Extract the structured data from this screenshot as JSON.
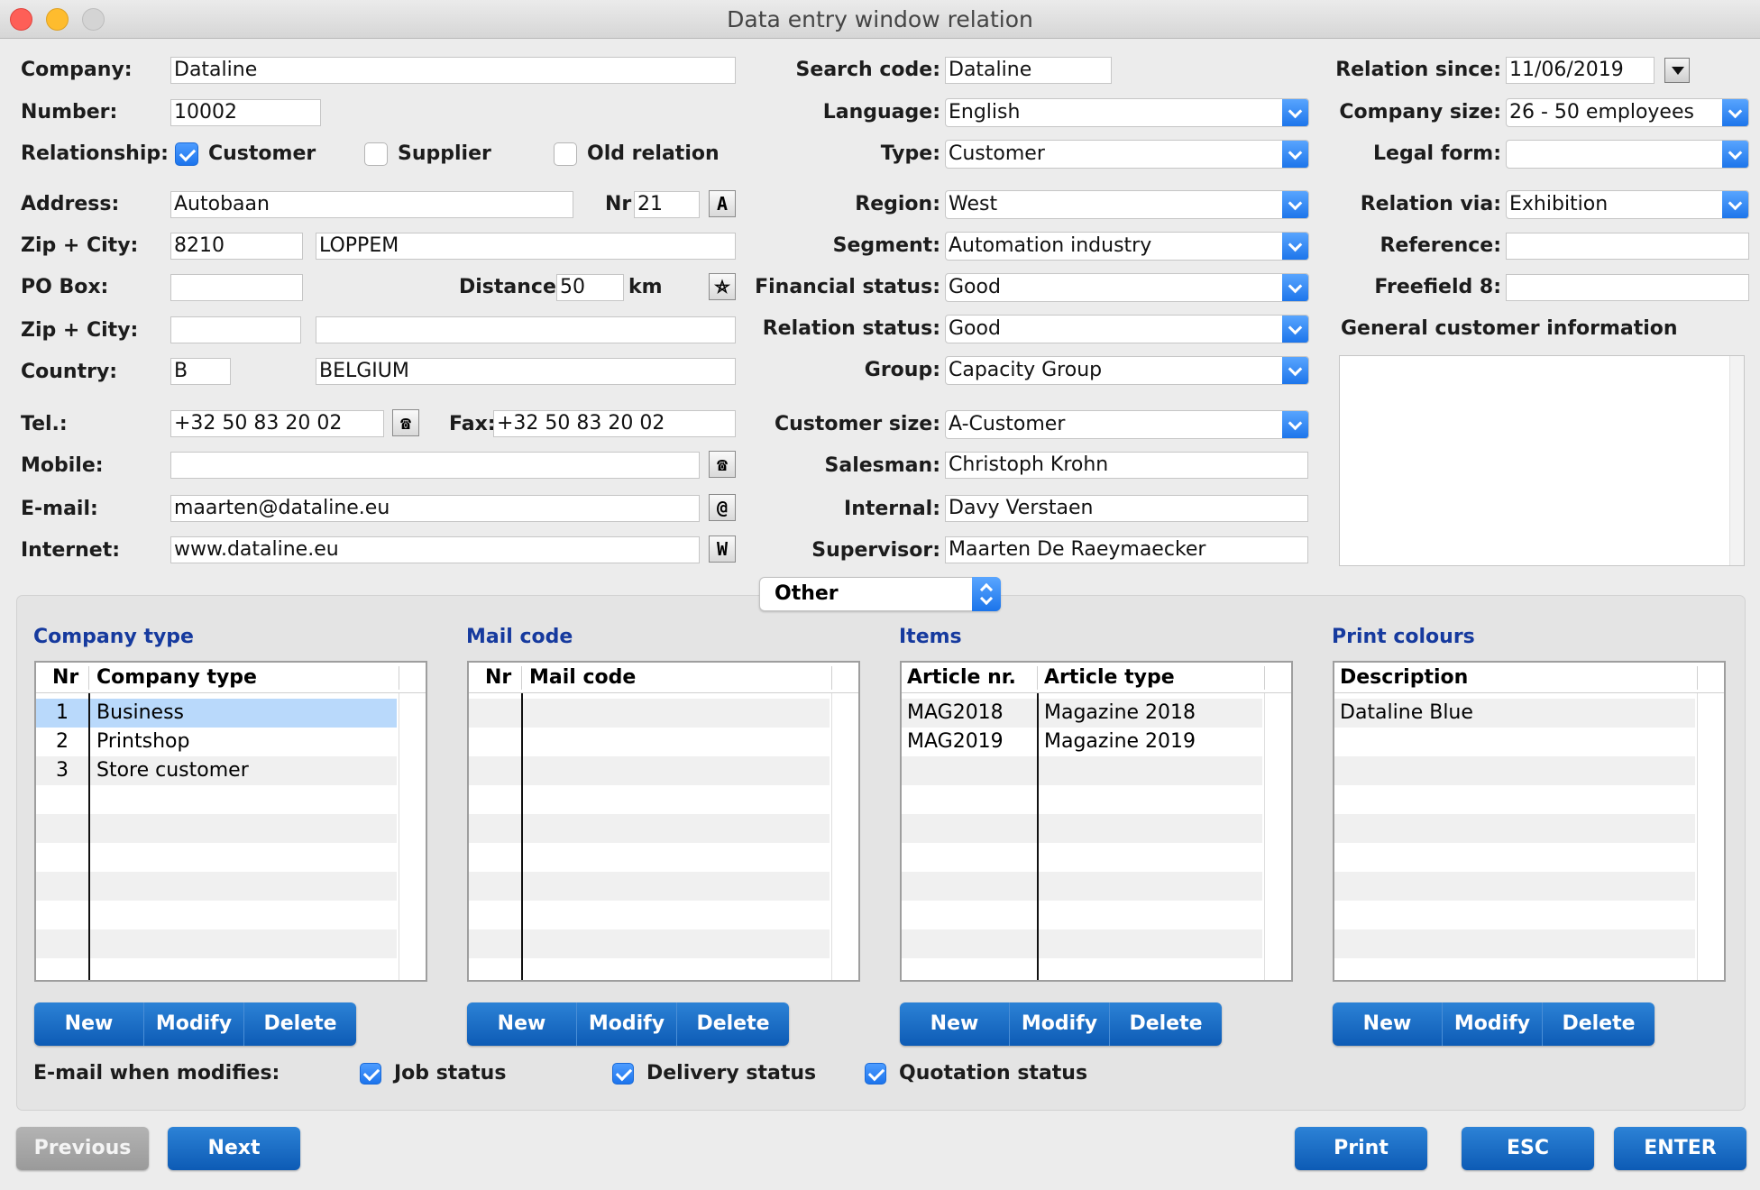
{
  "window": {
    "title": "Data entry window relation"
  },
  "left": {
    "company_label": "Company:",
    "company": "Dataline",
    "number_label": "Number:",
    "number": "10002",
    "relationship_label": "Relationship:",
    "customer_label": "Customer",
    "supplier_label": "Supplier",
    "old_relation_label": "Old relation",
    "address_label": "Address:",
    "address": "Autobaan",
    "nr_label": "Nr",
    "nr": "21",
    "zip_city_label": "Zip + City:",
    "zip": "8210",
    "city": "LOPPEM",
    "po_box_label": "PO Box:",
    "po_box": "",
    "distance_label": "Distance:",
    "distance": "50",
    "km_label": "km",
    "zip_city2_label": "Zip + City:",
    "zip2": "",
    "city2": "",
    "country_label": "Country:",
    "country_code": "B",
    "country": "BELGIUM",
    "tel_label": "Tel.:",
    "tel": "+32 50 83 20 02",
    "fax_label": "Fax:",
    "fax": "+32 50 83 20 02",
    "mobile_label": "Mobile:",
    "mobile": "",
    "email_label": "E-mail:",
    "email": "maarten@dataline.eu",
    "internet_label": "Internet:",
    "internet": "www.dataline.eu",
    "icons": {
      "address": "A",
      "distance": "⛤",
      "phone": "☎",
      "email": "@",
      "web": "W"
    }
  },
  "middle": {
    "search_code_label": "Search code:",
    "search_code": "Dataline",
    "language_label": "Language:",
    "language": "English",
    "type_label": "Type:",
    "type": "Customer",
    "region_label": "Region:",
    "region": "West",
    "segment_label": "Segment:",
    "segment": "Automation industry",
    "financial_status_label": "Financial status:",
    "financial_status": "Good",
    "relation_status_label": "Relation status:",
    "relation_status": "Good",
    "group_label": "Group:",
    "group": "Capacity Group",
    "customer_size_label": "Customer size:",
    "customer_size": "A-Customer",
    "salesman_label": "Salesman:",
    "salesman": "Christoph Krohn",
    "internal_label": "Internal:",
    "internal": "Davy Verstaen",
    "supervisor_label": "Supervisor:",
    "supervisor": "Maarten De Raeymaecker"
  },
  "right": {
    "relation_since_label": "Relation since:",
    "relation_since": "11/06/2019",
    "company_size_label": "Company size:",
    "company_size": "26 - 50 employees",
    "legal_form_label": "Legal form:",
    "legal_form": "",
    "relation_via_label": "Relation via:",
    "relation_via": "Exhibition",
    "reference_label": "Reference:",
    "reference": "",
    "freefield8_label": "Freefield 8:",
    "freefield8": "",
    "general_info_label": "General customer information",
    "general_info": ""
  },
  "other_popup": "Other",
  "tables": {
    "company_type": {
      "title": "Company type",
      "col1": "Nr",
      "col2": "Company type",
      "rows": [
        [
          "1",
          "Business"
        ],
        [
          "2",
          "Printshop"
        ],
        [
          "3",
          "Store customer"
        ]
      ]
    },
    "mail_code": {
      "title": "Mail code",
      "col1": "Nr",
      "col2": "Mail code",
      "rows": []
    },
    "items": {
      "title": "Items",
      "col1": "Article nr.",
      "col2": "Article type",
      "rows": [
        [
          "MAG2018",
          "Magazine 2018"
        ],
        [
          "MAG2019",
          "Magazine 2019"
        ]
      ]
    },
    "print_colours": {
      "title": "Print colours",
      "col1": "Description",
      "rows": [
        [
          "Dataline Blue"
        ]
      ]
    }
  },
  "table_buttons": {
    "new": "New",
    "modify": "Modify",
    "delete": "Delete"
  },
  "email_modifies": {
    "label": "E-mail when modifies:",
    "job_status": "Job status",
    "delivery_status": "Delivery status",
    "quotation_status": "Quotation status"
  },
  "footer": {
    "previous": "Previous",
    "next": "Next",
    "print": "Print",
    "esc": "ESC",
    "enter": "ENTER"
  }
}
